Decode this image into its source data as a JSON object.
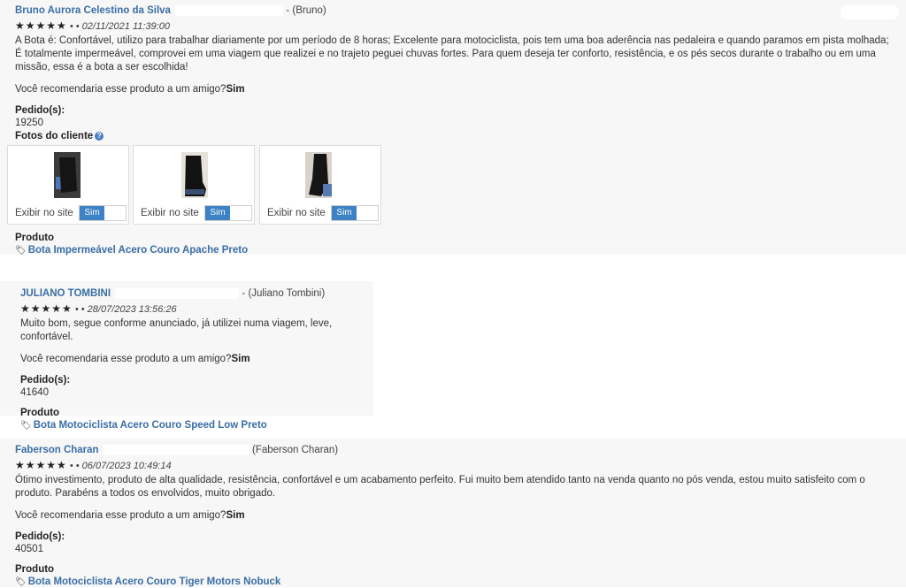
{
  "reviews": [
    {
      "author": "Bruno Aurora Celestino da Silva",
      "nickname": "- (Bruno)",
      "stars": "★★★★★",
      "date": "• • 02/11/2021 11:39:00",
      "text": "A Bota é: Confortável, utilizo para trabalhar diariamente por um período de 8 horas; Excelente para motociclista, pois tem uma boa aderência nas pedaleira e quando paramos em pista molhada; É totalmente impermeável, comprovei em uma viagem que realizei e no trajeto peguei chuvas fortes. Para quem deseja ter conforto, resistência, e os pés secos durante o trabalho ou em uma missão, essa é a bota a ser escolhida!",
      "recommend_question": "Você recomendaria esse produto a um amigo?",
      "recommend_answer": "Sim",
      "orders_label": "Pedido(s):",
      "order_number": "19250",
      "photos_label": "Fotos do cliente",
      "photos": [
        {
          "display_label": "Exibir no site",
          "toggle_value": "Sim"
        },
        {
          "display_label": "Exibir no site",
          "toggle_value": "Sim"
        },
        {
          "display_label": "Exibir no site",
          "toggle_value": "Sim"
        }
      ],
      "product_label": "Produto",
      "product_name": "Bota Impermeável Acero Couro Apache Preto"
    },
    {
      "author": "JULIANO TOMBINI",
      "nickname": "- (Juliano Tombini)",
      "stars": "★★★★★",
      "date": "• • 28/07/2023 13:56:26",
      "text": "Muito bom, segue conforme anunciado, já utilizei numa viagem, leve, confortável.",
      "recommend_question": "Você recomendaria esse produto a um amigo?",
      "recommend_answer": "Sim",
      "orders_label": "Pedido(s):",
      "order_number": "41640",
      "product_label": "Produto",
      "product_name": "Bota Motociclista Acero Couro Speed Low Preto"
    },
    {
      "author": "Faberson Charan",
      "nickname": "(Faberson Charan)",
      "stars": "★★★★★",
      "date": "• • 06/07/2023 10:49:14",
      "text": "Ótimo investimento, produto de alta qualidade, resistência, confortável e um acabamento perfeito. Fui muito bem atendido tanto na venda quanto no pós venda, estou muito satisfeito com o produto. Parabéns a todos os envolvidos, muito obrigado.",
      "recommend_question": "Você recomendaria esse produto a um amigo?",
      "recommend_answer": "Sim",
      "orders_label": "Pedido(s):",
      "order_number": "40501",
      "product_label": "Produto",
      "product_name": "Bota Motociclista Acero Couro Tiger Motors Nobuck"
    }
  ],
  "icons": {
    "star": "star-icon",
    "tag": "tag-icon",
    "help": "help-circle-icon"
  },
  "colors": {
    "link": "#3a6ea5",
    "toggle_on": "#3c82c4",
    "panel_bg": "#f7f7f7"
  }
}
